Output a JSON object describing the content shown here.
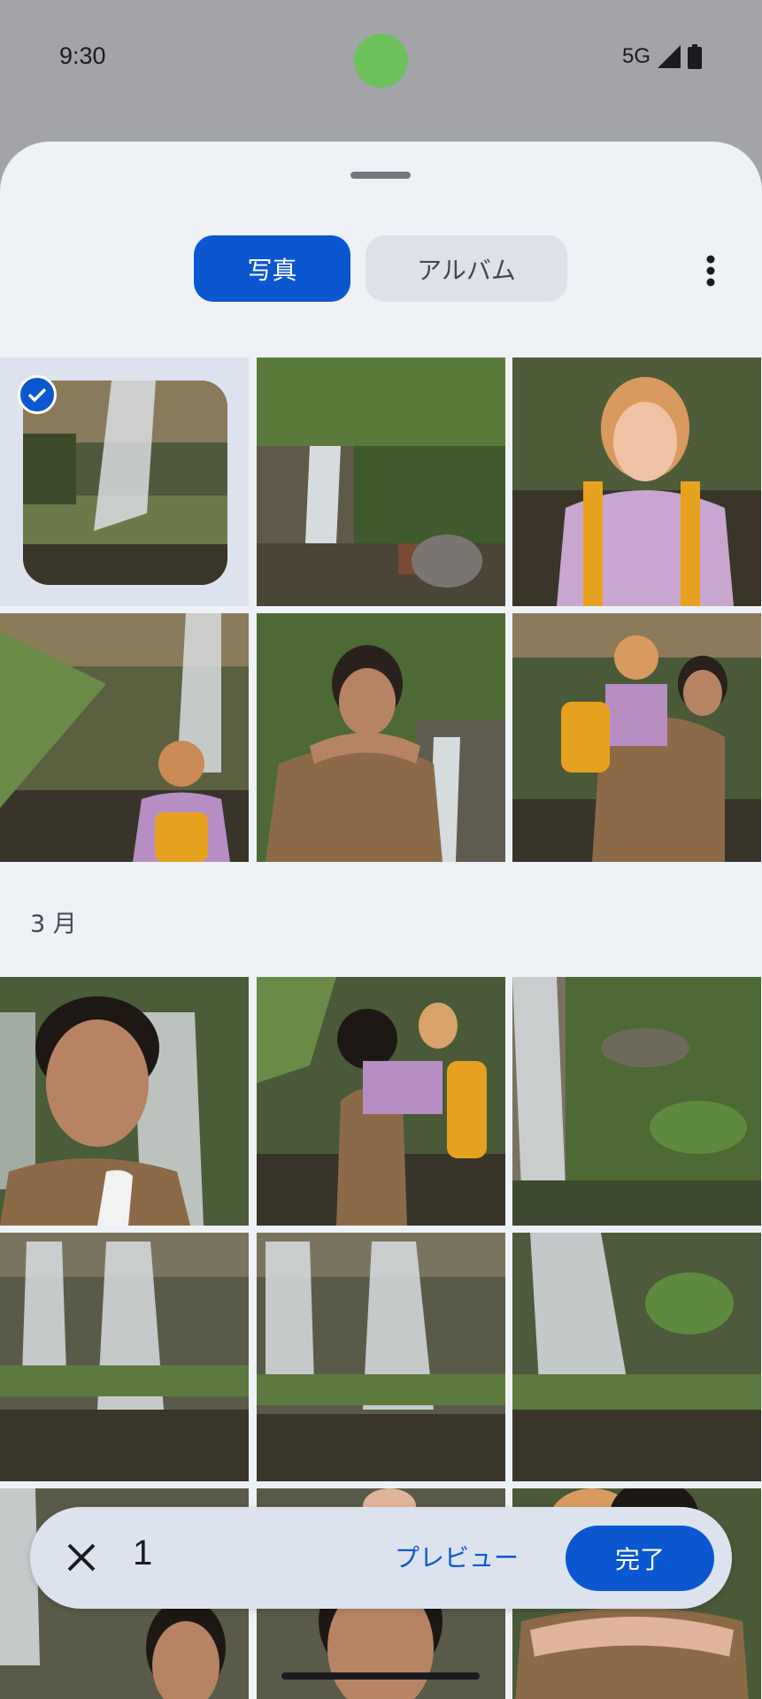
{
  "status": {
    "time": "9:30",
    "network": "5G"
  },
  "tabs": {
    "photos": "写真",
    "albums": "アルバム"
  },
  "section": {
    "month": "3 月"
  },
  "selection": {
    "count": "1",
    "preview_label": "プレビュー",
    "done_label": "完了"
  },
  "colors": {
    "accent": "#0b57d0",
    "sheet_bg": "#eef1f6",
    "camera_dot": "#6cc15a"
  },
  "photos_top": [
    {
      "name": "waterfall-photo",
      "selected": true
    },
    {
      "name": "garden-waterfall-photo",
      "selected": false
    },
    {
      "name": "woman-smiling-photo",
      "selected": false
    },
    {
      "name": "woman-back-photo",
      "selected": false
    },
    {
      "name": "man-hug-photo",
      "selected": false
    },
    {
      "name": "piggyback-photo",
      "selected": false
    }
  ],
  "photos_march": [
    {
      "name": "man-selfie-photo"
    },
    {
      "name": "piggyback-side-photo"
    },
    {
      "name": "waterfall-ferns-photo"
    },
    {
      "name": "waterfall-rocks-photo"
    },
    {
      "name": "waterfall-rocks-2-photo"
    },
    {
      "name": "waterfall-pool-photo"
    },
    {
      "name": "waterfall-partial-photo"
    },
    {
      "name": "man-closeup-photo"
    },
    {
      "name": "couple-closeup-photo"
    }
  ]
}
